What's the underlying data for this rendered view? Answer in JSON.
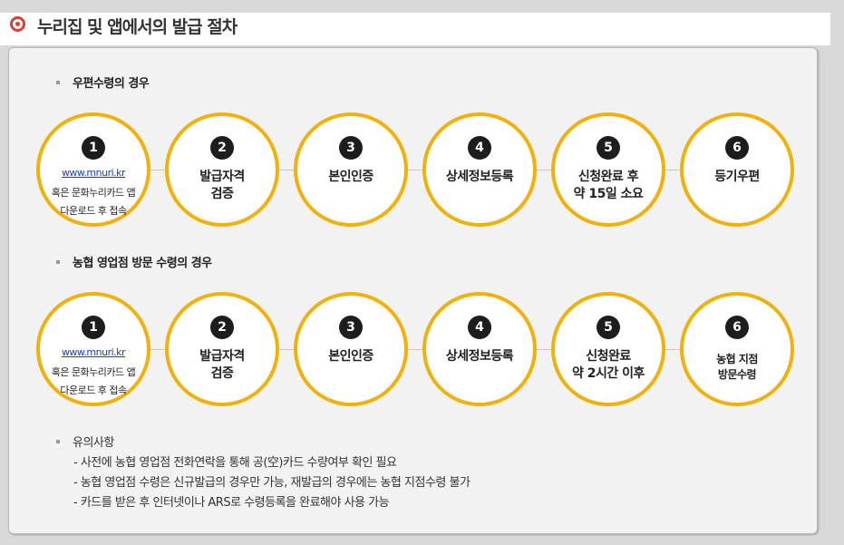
{
  "page": {
    "title": "누리집 및 앱에서의 발급 절차"
  },
  "sections": [
    {
      "heading": "우편수령의 경우",
      "steps": [
        {
          "num": "1",
          "link": "www.mnuri.kr",
          "text": "혹은 문화누리카드 앱\n다운로드 후 접속"
        },
        {
          "num": "2",
          "text": "발급자격\n검증"
        },
        {
          "num": "3",
          "text": "본인인증"
        },
        {
          "num": "4",
          "text": "상세정보등록"
        },
        {
          "num": "5",
          "text": "신청완료 후\n약 15일 소요"
        },
        {
          "num": "6",
          "text": "등기우편"
        }
      ]
    },
    {
      "heading": "농협 영업점 방문 수령의 경우",
      "steps": [
        {
          "num": "1",
          "link": "www.mnuri.kr",
          "text": "혹은 문화누리카드 앱\n다운로드 후 접속"
        },
        {
          "num": "2",
          "text": "발급자격\n검증"
        },
        {
          "num": "3",
          "text": "본인인증"
        },
        {
          "num": "4",
          "text": "상세정보등록"
        },
        {
          "num": "5",
          "text": "신청완료\n약 2시간 이후"
        },
        {
          "num": "6",
          "text": "농협 지점\n방문수령"
        }
      ]
    }
  ],
  "notes": {
    "heading": "유의사항",
    "items": [
      "- 사전에 농협 영업점 전화연락을 통해 공(空)카드 수량여부 확인 필요",
      "- 농협 영업점 수령은 신규발급의 경우만 가능, 재발급의 경우에는 농협 지점수령 불가",
      "- 카드를 받은 후 인터넷이나 ARS로 수령등록을 완료해야 사용 가능"
    ]
  },
  "colors": {
    "accent_circle": "#f0b10a",
    "title_bullet": "#e03b3b",
    "link": "#1a3fbf"
  }
}
